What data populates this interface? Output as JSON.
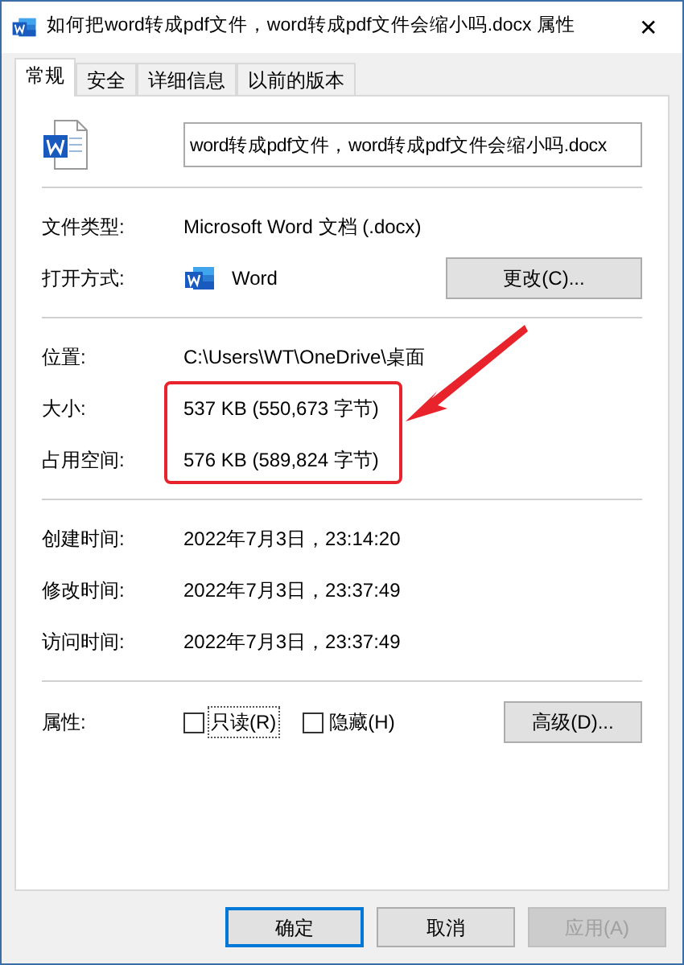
{
  "window": {
    "title": "如何把word转成pdf文件，word转成pdf文件会缩小吗.docx 属性",
    "close": "✕"
  },
  "tabs": [
    {
      "label": "常规",
      "selected": true
    },
    {
      "label": "安全",
      "selected": false
    },
    {
      "label": "详细信息",
      "selected": false
    },
    {
      "label": "以前的版本",
      "selected": false
    }
  ],
  "file_name": {
    "value": "word转成pdf文件，word转成pdf文件会缩小吗.docx"
  },
  "sections": [
    [
      {
        "label": "文件类型:",
        "value": "Microsoft Word 文档 (.docx)"
      },
      {
        "label": "打开方式:",
        "value": "Word",
        "app_icon": true,
        "button": "更改(C)..."
      }
    ],
    [
      {
        "label": "位置:",
        "value": "C:\\Users\\WT\\OneDrive\\桌面"
      },
      {
        "label": "大小:",
        "value": "537 KB (550,673 字节)"
      },
      {
        "label": "占用空间:",
        "value": "576 KB (589,824 字节)"
      }
    ],
    [
      {
        "label": "创建时间:",
        "value": "2022年7月3日，23:14:20"
      },
      {
        "label": "修改时间:",
        "value": "2022年7月3日，23:37:49"
      },
      {
        "label": "访问时间:",
        "value": "2022年7月3日，23:37:49"
      }
    ]
  ],
  "attributes": {
    "label": "属性:",
    "checkboxes": [
      {
        "label": "只读(R)",
        "checked": false,
        "focused": true
      },
      {
        "label": "隐藏(H)",
        "checked": false,
        "focused": false
      }
    ],
    "button": "高级(D)..."
  },
  "buttons": [
    {
      "label": "确定",
      "default": true,
      "disabled": false
    },
    {
      "label": "取消",
      "default": false,
      "disabled": false
    },
    {
      "label": "应用(A)",
      "default": false,
      "disabled": true
    }
  ]
}
